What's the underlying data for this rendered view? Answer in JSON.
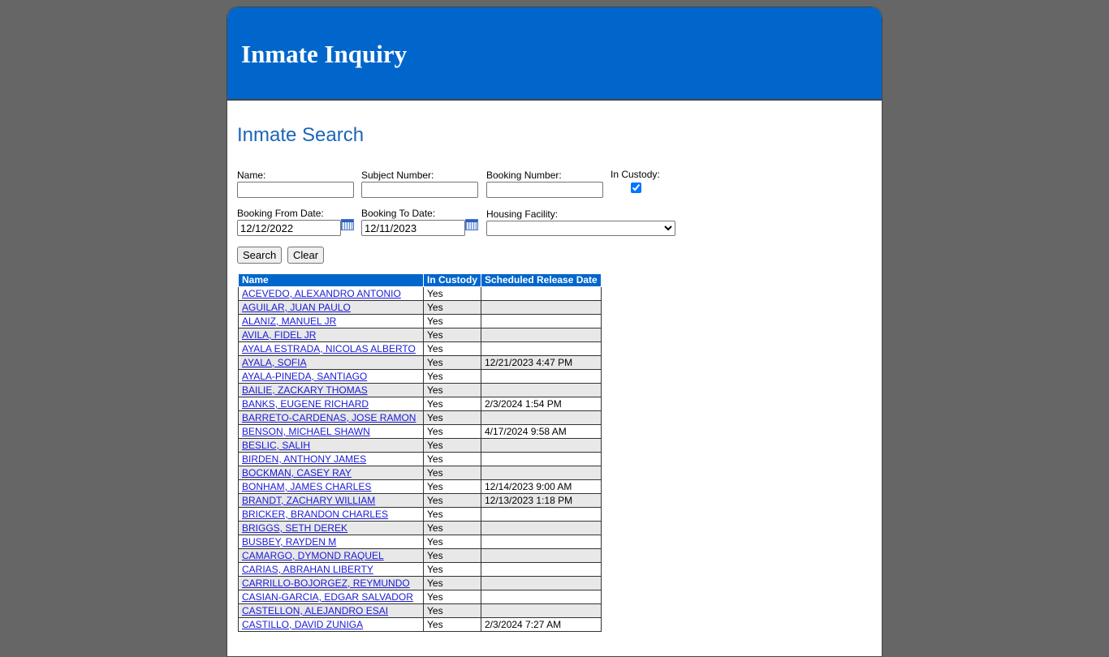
{
  "header": {
    "title": "Inmate Inquiry"
  },
  "search": {
    "title": "Inmate Search",
    "name_label": "Name:",
    "name_value": "",
    "subject_label": "Subject Number:",
    "subject_value": "",
    "booking_label": "Booking Number:",
    "booking_value": "",
    "custody_label": "In Custody:",
    "custody_checked": true,
    "from_label": "Booking From Date:",
    "from_value": "12/12/2022",
    "to_label": "Booking To Date:",
    "to_value": "12/11/2023",
    "facility_label": "Housing Facility:",
    "facility_value": "",
    "search_button": "Search",
    "clear_button": "Clear"
  },
  "results": {
    "columns": [
      "Name",
      "In Custody",
      "Scheduled Release Date"
    ],
    "rows": [
      {
        "name": "ACEVEDO, ALEXANDRO ANTONIO",
        "custody": "Yes",
        "release": ""
      },
      {
        "name": "AGUILAR, JUAN PAULO",
        "custody": "Yes",
        "release": ""
      },
      {
        "name": "ALANIZ, MANUEL JR",
        "custody": "Yes",
        "release": ""
      },
      {
        "name": "AVILA, FIDEL JR",
        "custody": "Yes",
        "release": ""
      },
      {
        "name": "AYALA ESTRADA, NICOLAS ALBERTO",
        "custody": "Yes",
        "release": ""
      },
      {
        "name": "AYALA, SOFIA",
        "custody": "Yes",
        "release": "12/21/2023 4:47 PM"
      },
      {
        "name": "AYALA-PINEDA, SANTIAGO",
        "custody": "Yes",
        "release": ""
      },
      {
        "name": "BAILIE, ZACKARY THOMAS",
        "custody": "Yes",
        "release": ""
      },
      {
        "name": "BANKS, EUGENE RICHARD",
        "custody": "Yes",
        "release": "2/3/2024 1:54 PM"
      },
      {
        "name": "BARRETO-CARDENAS, JOSE RAMON",
        "custody": "Yes",
        "release": ""
      },
      {
        "name": "BENSON, MICHAEL SHAWN",
        "custody": "Yes",
        "release": "4/17/2024 9:58 AM"
      },
      {
        "name": "BESLIC, SALIH",
        "custody": "Yes",
        "release": ""
      },
      {
        "name": "BIRDEN, ANTHONY JAMES",
        "custody": "Yes",
        "release": ""
      },
      {
        "name": "BOCKMAN, CASEY RAY",
        "custody": "Yes",
        "release": ""
      },
      {
        "name": "BONHAM, JAMES CHARLES",
        "custody": "Yes",
        "release": "12/14/2023 9:00 AM"
      },
      {
        "name": "BRANDT, ZACHARY WILLIAM",
        "custody": "Yes",
        "release": "12/13/2023 1:18 PM"
      },
      {
        "name": "BRICKER, BRANDON CHARLES",
        "custody": "Yes",
        "release": ""
      },
      {
        "name": "BRIGGS, SETH DEREK",
        "custody": "Yes",
        "release": ""
      },
      {
        "name": "BUSBEY, RAYDEN M",
        "custody": "Yes",
        "release": ""
      },
      {
        "name": "CAMARGO, DYMOND RAQUEL",
        "custody": "Yes",
        "release": ""
      },
      {
        "name": "CARIAS, ABRAHAN LIBERTY",
        "custody": "Yes",
        "release": ""
      },
      {
        "name": "CARRILLO-BOJORGEZ, REYMUNDO",
        "custody": "Yes",
        "release": ""
      },
      {
        "name": "CASIAN-GARCIA, EDGAR SALVADOR",
        "custody": "Yes",
        "release": ""
      },
      {
        "name": "CASTELLON, ALEJANDRO ESAI",
        "custody": "Yes",
        "release": ""
      },
      {
        "name": "CASTILLO, DAVID ZUNIGA",
        "custody": "Yes",
        "release": "2/3/2024 7:27 AM"
      }
    ]
  }
}
